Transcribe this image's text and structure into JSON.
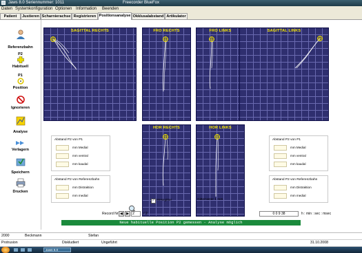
{
  "window": {
    "title_left": "Jaws 8.0  Seriennummer: 1011",
    "title_center": "Freecorder BlueFox"
  },
  "menu": [
    "Daten",
    "Systemkonfiguration",
    "Optionen",
    "Information",
    "Beenden"
  ],
  "tabs": [
    "Patient",
    "Justieren",
    "Scharnierachse",
    "Registrieren",
    "Positionsanalyse",
    "Okklusalabstand",
    "Artikulator"
  ],
  "active_tab": "Positionsanalyse",
  "toolbar": {
    "referenzbahn": "Referenzbahn",
    "p2_badge": "P2",
    "habituell": "Habituell",
    "p1_badge": "P1",
    "position": "Position",
    "ignorieren": "Ignorieren",
    "analyse": "Analyse",
    "verlagern": "Verlagern",
    "speichern": "Speichern",
    "drucken": "Drucken"
  },
  "panels": {
    "sagittal_rechts": "SAGITTAL RECHTS",
    "fro_rechts": "FRO RECHTS",
    "fro_links": "FRO LINKS",
    "sagittal_links": "SAGITTAL LINKS",
    "hor_rechts": "HOR RECHTS",
    "hor_links": "HOR LINKS"
  },
  "groups": {
    "p1_title": "Abstand P2 von P1",
    "ref_title": "Abstand P2 von Referenzbahn",
    "units_p1": [
      "mm Medial",
      "mm ventral",
      "mm kaudal"
    ],
    "units_ref": [
      "mm Distraktion",
      "mm medial"
    ]
  },
  "messgitter": "Messgitter",
  "gitterraster": "Gitterraster 1 mm",
  "record": {
    "label": "Record Nr",
    "current": "2",
    "total": "/ 2"
  },
  "time": {
    "value": "0  0  9  38",
    "label": "h : min : sec : msec"
  },
  "message": "Neue habituelle Position P2 gemessen - Analyse möglich",
  "status": {
    "row1": {
      "year": "2000",
      "name": "Beckmann",
      "first": "Stefan"
    },
    "row2": {
      "left": "Protrusion",
      "mid1": "Diskludiert",
      "mid2": "Ungeführt",
      "date": "31.10.2008"
    }
  },
  "taskbar": {
    "task": "Jaws 8.0"
  },
  "colors": {
    "panel_bg": "#2f2f6f",
    "panel_title": "#f8e800",
    "message_bar": "#1b8a3c",
    "trace": "#ffffff"
  }
}
